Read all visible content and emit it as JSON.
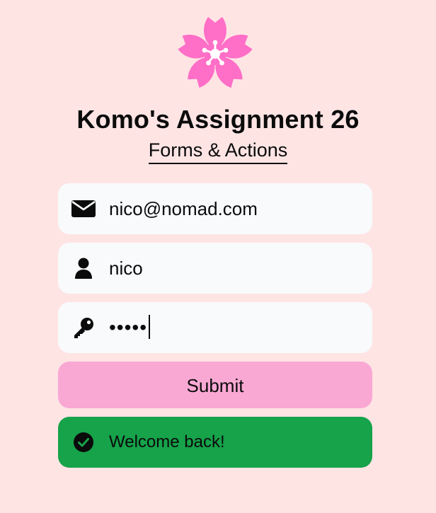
{
  "header": {
    "title": "Komo's Assignment 26",
    "subtitle": "Forms & Actions",
    "logo_icon": "cherry-blossom-icon",
    "logo_color": "#FF6EC7"
  },
  "form": {
    "email": {
      "icon": "envelope-icon",
      "value": "nico@nomad.com"
    },
    "username": {
      "icon": "user-icon",
      "value": "nico"
    },
    "password": {
      "icon": "key-icon",
      "display": "•••••"
    },
    "submit_label": "Submit"
  },
  "status": {
    "icon": "check-circle-icon",
    "message": "Welcome back!",
    "color": "#16A34A"
  },
  "colors": {
    "background": "#FFE4E4",
    "field_background": "#F8FAFC",
    "submit_background": "#F9A8D4"
  }
}
